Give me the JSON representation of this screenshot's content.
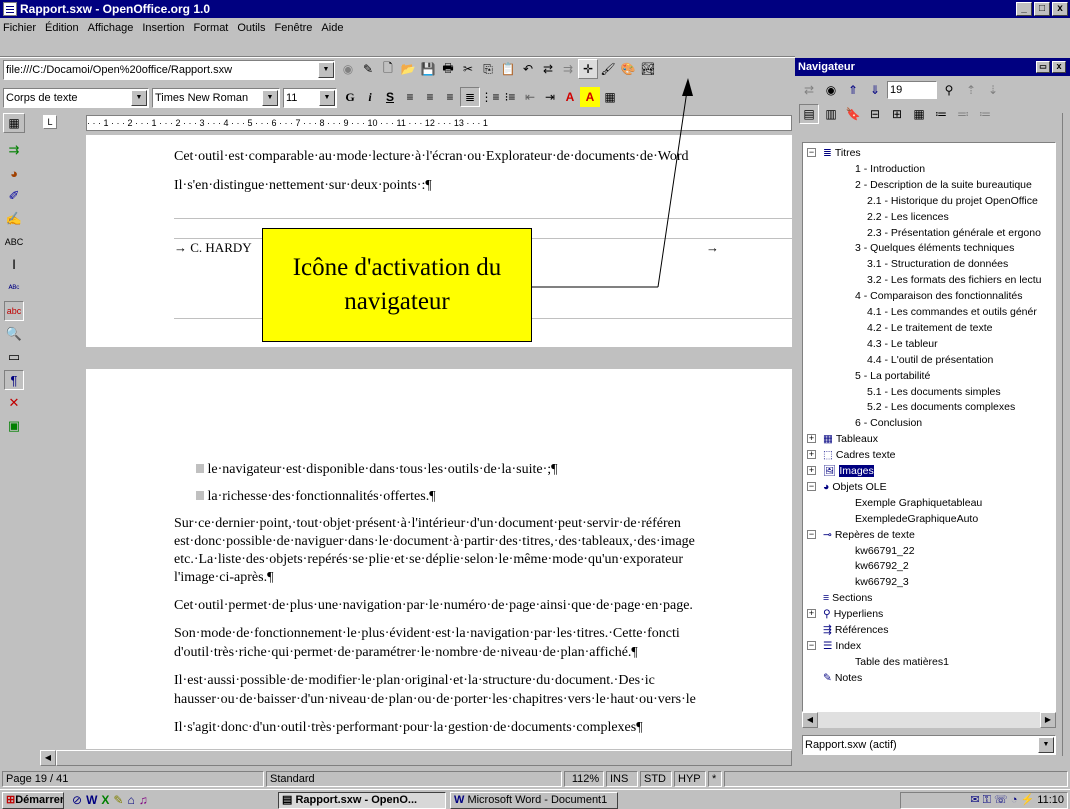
{
  "window": {
    "title": "Rapport.sxw - OpenOffice.org 1.0",
    "min": "_",
    "max": "□",
    "close": "x"
  },
  "menu": [
    "Fichier",
    "Édition",
    "Affichage",
    "Insertion",
    "Format",
    "Outils",
    "Fenêtre",
    "Aide"
  ],
  "url": "file:///C:/Docamoi/Open%20office/Rapport.sxw",
  "format": {
    "style": "Corps de texte",
    "font": "Times New Roman",
    "size": "11",
    "bold": "G",
    "italic": "i",
    "underline": "S",
    "color_a": "A",
    "highlight": "A"
  },
  "ruler": " · · · 1 · · · 2 · · · 1 · · · 2 · · · 3 · · · 4 · · · 5 · · · 6 · · · 7 · · · 8 · · · 9 · · · 10 · · · 11 · · · 12 · · · 13 · · · 1",
  "document": {
    "line1": "Cet·outil·est·comparable·au·mode·lecture·à·l'écran·ou·Explorateur·de·documents·de·Word",
    "line2": "Il·s'en·distingue·nettement·sur·deux·points·:¶",
    "footer_name": "→ C. HARDY",
    "footer_arrow": "→",
    "bullet1": "le·navigateur·est·disponible·dans·tous·les·outils·de·la·suite·;¶",
    "bullet2": "la·richesse·des·fonctionnalités·offertes.¶",
    "p1a": "Sur·ce·dernier·point,·tout·objet·présent·à·l'intérieur·d'un·document·peut·servir·de·référen",
    "p1b": "est·donc·possible·de·naviguer·dans·le·document·à·partir·des·titres,·des·tableaux,·des·image",
    "p1c": "etc.·La·liste·des·objets·repérés·se·plie·et·se·déplie·selon·le·même·mode·qu'un·exporateur",
    "p1d": "l'image·ci-après.¶",
    "p2": "Cet·outil·permet·de·plus·une·navigation·par·le·numéro·de·page·ainsi·que·de·page·en·page.",
    "p3a": "Son·mode·de·fonctionnement·le·plus·évident·est·la·navigation·par·les·titres.·Cette·foncti",
    "p3b": "d'outil·très·riche·qui·permet·de·paramétrer·le·nombre·de·niveau·de·plan·affiché.¶",
    "p4a": "Il·est·aussi·possible·de·modifier·le·plan·original·et·la·structure·du·document.·Des·ic",
    "p4b": "hausser·ou·de·baisser·d'un·niveau·de·plan·ou·de·porter·les·chapitres·vers·le·haut·ou·vers·le",
    "p5": "Il·s'agit·donc·d'un·outil·très·performant·pour·la·gestion·de·documents·complexes¶"
  },
  "callout": {
    "line1": "Icône d'activation du",
    "line2": "navigateur"
  },
  "navigator": {
    "title": "Navigateur",
    "page_number": "19",
    "doc_select": "Rapport.sxw (actif)",
    "tree": [
      {
        "id": "titres",
        "label": "Titres",
        "level": 0,
        "pm": "⊟"
      },
      {
        "id": "t1",
        "label": "1 - Introduction",
        "level": 2
      },
      {
        "id": "t2",
        "label": "2 - Description de la suite bureautique",
        "level": 2
      },
      {
        "id": "t21",
        "label": "2.1 - Historique du projet OpenOffice",
        "level": 3
      },
      {
        "id": "t22",
        "label": "2.2 - Les licences",
        "level": 3
      },
      {
        "id": "t23",
        "label": "2.3 - Présentation générale et ergono",
        "level": 3
      },
      {
        "id": "t3",
        "label": "3 - Quelques éléments techniques",
        "level": 2
      },
      {
        "id": "t31",
        "label": "3.1 - Structuration de données",
        "level": 3
      },
      {
        "id": "t32",
        "label": "3.2 - Les formats des fichiers en lectu",
        "level": 3
      },
      {
        "id": "t4",
        "label": "4 - Comparaison des fonctionnalités",
        "level": 2
      },
      {
        "id": "t41",
        "label": "4.1 - Les commandes et outils génér",
        "level": 3
      },
      {
        "id": "t42",
        "label": "4.2 - Le traitement de texte",
        "level": 3
      },
      {
        "id": "t43",
        "label": "4.3 - Le tableur",
        "level": 3
      },
      {
        "id": "t44",
        "label": "4.4 - L'outil de présentation",
        "level": 3
      },
      {
        "id": "t5",
        "label": "5 - La portabilité",
        "level": 2
      },
      {
        "id": "t51",
        "label": "5.1 - Les documents simples",
        "level": 3
      },
      {
        "id": "t52",
        "label": "5.2 - Les documents complexes",
        "level": 3
      },
      {
        "id": "t6",
        "label": "6 - Conclusion",
        "level": 2
      },
      {
        "id": "tableaux",
        "label": "Tableaux",
        "level": 0,
        "pm": "⊞"
      },
      {
        "id": "cadres",
        "label": "Cadres texte",
        "level": 0,
        "pm": "⊞"
      },
      {
        "id": "images",
        "label": "Images",
        "level": 0,
        "pm": "⊞",
        "selected": true
      },
      {
        "id": "ole",
        "label": "Objets OLE",
        "level": 0,
        "pm": "⊟"
      },
      {
        "id": "ole1",
        "label": "Exemple Graphiquetableau",
        "level": 1
      },
      {
        "id": "ole2",
        "label": "ExempledeGraphiqueAuto",
        "level": 1
      },
      {
        "id": "reperes",
        "label": "Repères de texte",
        "level": 0,
        "pm": "⊟"
      },
      {
        "id": "r1",
        "label": "kw66791_22",
        "level": 1
      },
      {
        "id": "r2",
        "label": "kw66792_2",
        "level": 1
      },
      {
        "id": "r3",
        "label": "kw66792_3",
        "level": 1
      },
      {
        "id": "sections",
        "label": "Sections",
        "level": 0
      },
      {
        "id": "hyperliens",
        "label": "Hyperliens",
        "level": 0,
        "pm": "⊞"
      },
      {
        "id": "references",
        "label": "Références",
        "level": 0
      },
      {
        "id": "index",
        "label": "Index",
        "level": 0,
        "pm": "⊟"
      },
      {
        "id": "toc",
        "label": "Table des matières1",
        "level": 1
      },
      {
        "id": "notes",
        "label": "Notes",
        "level": 0
      }
    ]
  },
  "status": {
    "page": "Page 19 / 41",
    "style": "Standard",
    "zoom": "112%",
    "ins": "INS",
    "std": "STD",
    "hyp": "HYP",
    "star": "*"
  },
  "taskbar": {
    "start": "Démarrer",
    "task1": "Rapport.sxw - OpenO...",
    "task2": "Microsoft Word - Document1",
    "clock": "11:10"
  },
  "colors": {
    "titlebar": "#000080",
    "callout": "#ffff00",
    "face": "#c0c0c0"
  }
}
